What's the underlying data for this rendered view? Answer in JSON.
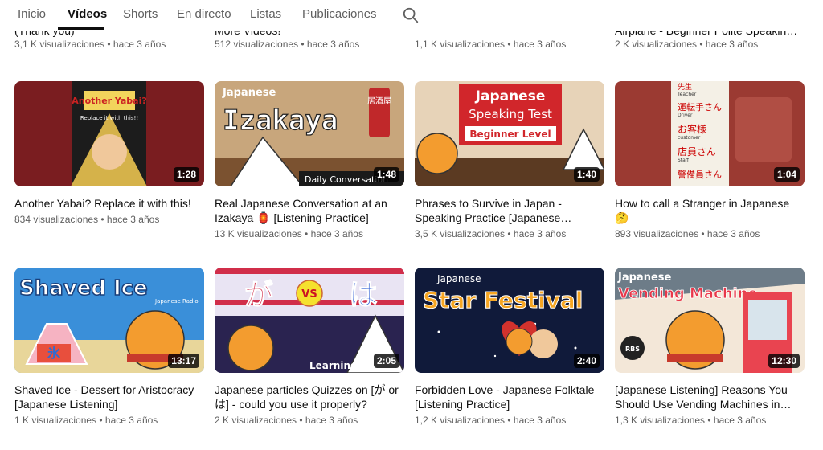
{
  "tabs": [
    {
      "label": "Inicio"
    },
    {
      "label": "Vídeos"
    },
    {
      "label": "Shorts"
    },
    {
      "label": "En directo"
    },
    {
      "label": "Listas"
    },
    {
      "label": "Publicaciones"
    }
  ],
  "top_row": [
    {
      "title": "(Thank you)",
      "meta": "3,1 K visualizaciones • hace 3 años"
    },
    {
      "title": "More Videos!",
      "meta": "512 visualizaciones • hace 3 años"
    },
    {
      "title": "",
      "meta": "1,1 K visualizaciones • hace 3 años"
    },
    {
      "title": "Airplane - Beginner Polite Speakin…",
      "meta": "2 K visualizaciones • hace 3 años"
    }
  ],
  "videos": [
    {
      "title": "Another Yabai? Replace it with this!",
      "views": "834 visualizaciones • hace 3 años",
      "duration": "1:28",
      "thumb_text": "Another Yabai?",
      "thumb_sub": "Replace it with this!!",
      "bg": "#7a1d20"
    },
    {
      "title": "Real Japanese Conversation at an Izakaya 🏮 [Listening Practice]",
      "views": "13 K visualizaciones • hace 3 años",
      "duration": "1:48",
      "thumb_text": "Izakaya",
      "thumb_top": "Japanese",
      "thumb_sub": "Daily Conversation",
      "thumb_kanji": "居酒屋",
      "bg": "#c8a67c"
    },
    {
      "title": "Phrases to Survive in Japan - Speaking Practice [Japanese…",
      "views": "3,5 K visualizaciones • hace 3 años",
      "duration": "1:40",
      "thumb_text": "Japanese",
      "thumb_top": "Speaking Test",
      "thumb_sub": "Beginner Level",
      "bg": "#e7d3b8"
    },
    {
      "title": "How to call a Stranger in Japanese 🤔",
      "views": "893 visualizaciones • hace 3 años",
      "duration": "1:04",
      "thumb_words": [
        "先生",
        "Teacher",
        "運転手さん",
        "Driver",
        "お客様",
        "customer",
        "店員さん",
        "Staff",
        "警備員さん"
      ],
      "bg": "#9b3a32"
    },
    {
      "title": "Shaved Ice - Dessert for Aristocracy [Japanese Listening]",
      "views": "1 K visualizaciones • hace 3 años",
      "duration": "13:17",
      "thumb_text": "Shaved Ice",
      "thumb_sub": "Japanese Radio",
      "thumb_kanji": "氷",
      "bg": "#3a8fd9"
    },
    {
      "title": "Japanese particles Quizzes on [が or は] - could you use it properly?",
      "views": "2 K visualizaciones • hace 3 años",
      "duration": "2:05",
      "thumb_text": "が",
      "thumb_top": "VS",
      "thumb_kanji": "は",
      "thumb_sub": "Learning Game",
      "bg": "#2a2350"
    },
    {
      "title": "Forbidden Love - Japanese Folktale [Listening Practice]",
      "views": "1,2 K visualizaciones • hace 3 años",
      "duration": "2:40",
      "thumb_text": "Star Festival",
      "thumb_top": "Japanese",
      "bg": "#101a3a"
    },
    {
      "title": "[Japanese Listening] Reasons You Should Use Vending Machines in…",
      "views": "1,3 K visualizaciones • hace 3 años",
      "duration": "12:30",
      "thumb_text": "Vending Machine",
      "thumb_top": "Japanese",
      "thumb_sub": "RBS",
      "bg": "#f3e7d8"
    }
  ],
  "colors": {
    "accent": "#0f0f0f",
    "meta": "#606060",
    "overlay": "#000000cc"
  }
}
